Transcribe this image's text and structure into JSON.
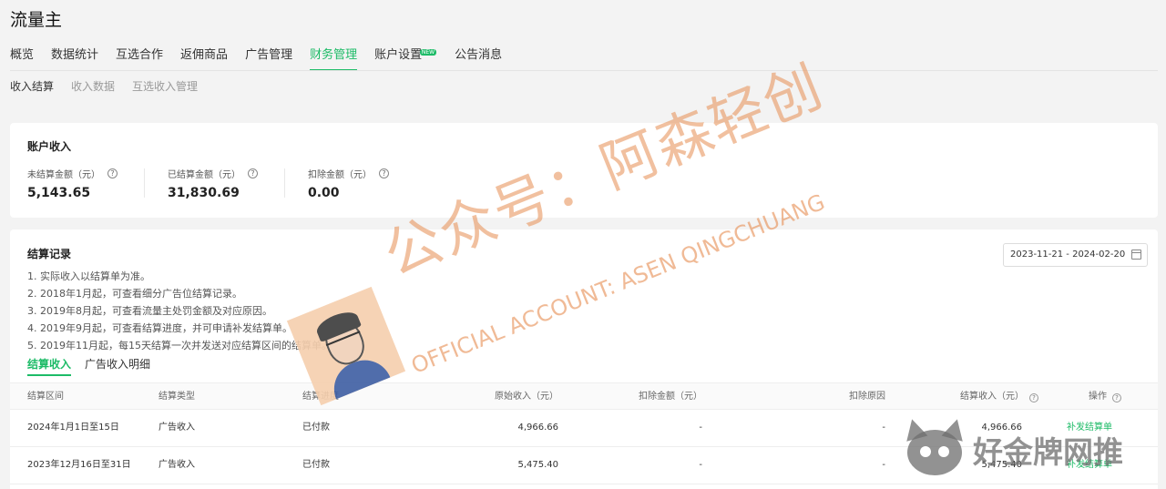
{
  "app": {
    "title": "流量主"
  },
  "main_nav": [
    {
      "label": "概览",
      "active": false
    },
    {
      "label": "数据统计",
      "active": false
    },
    {
      "label": "互选合作",
      "active": false
    },
    {
      "label": "返佣商品",
      "active": false
    },
    {
      "label": "广告管理",
      "active": false
    },
    {
      "label": "财务管理",
      "active": true
    },
    {
      "label": "账户设置",
      "active": false,
      "badge": "NEW"
    },
    {
      "label": "公告消息",
      "active": false
    }
  ],
  "sub_nav": [
    {
      "label": "收入结算",
      "active": true
    },
    {
      "label": "收入数据",
      "active": false
    },
    {
      "label": "互选收入管理",
      "active": false
    }
  ],
  "account": {
    "title": "账户收入",
    "stats": [
      {
        "label": "未结算金额（元）",
        "value": "5,143.65"
      },
      {
        "label": "已结算金额（元）",
        "value": "31,830.69"
      },
      {
        "label": "扣除金额（元）",
        "value": "0.00"
      }
    ]
  },
  "records": {
    "title": "结算记录",
    "date_range": "2023-11-21 - 2024-02-20",
    "notes": [
      "1. 实际收入以结算单为准。",
      "2. 2018年1月起，可查看细分广告位结算记录。",
      "3. 2019年8月起，可查看流量主处罚金额及对应原因。",
      "4. 2019年9月起，可查看结算进度，并可申请补发结算单。",
      "5. 2019年11月起，每15天结算一次并发送对应结算区间的结算单。"
    ],
    "tabs": [
      {
        "label": "结算收入",
        "active": true
      },
      {
        "label": "广告收入明细",
        "active": false
      }
    ],
    "columns": [
      "结算区间",
      "结算类型",
      "结算进度",
      "原始收入（元）",
      "扣除金额（元）",
      "扣除原因",
      "结算收入（元）",
      "操作"
    ],
    "rows": [
      {
        "period": "2024年1月1日至15日",
        "type": "广告收入",
        "status": "已付款",
        "original": "4,966.66",
        "deduct": "-",
        "reason": "-",
        "income": "4,966.66",
        "action": "补发结算单"
      },
      {
        "period": "2023年12月16日至31日",
        "type": "广告收入",
        "status": "已付款",
        "original": "5,475.40",
        "deduct": "-",
        "reason": "-",
        "income": "5,475.40",
        "action": "补发结算单"
      }
    ]
  },
  "watermark": {
    "cn": "公众号：阿森轻创",
    "en": "OFFICIAL ACCOUNT: ASEN QINGCHUANG",
    "brand": "好金牌网推"
  },
  "colors": {
    "accent": "#1dbb67",
    "background": "#f3f3f3",
    "card": "#ffffff"
  }
}
